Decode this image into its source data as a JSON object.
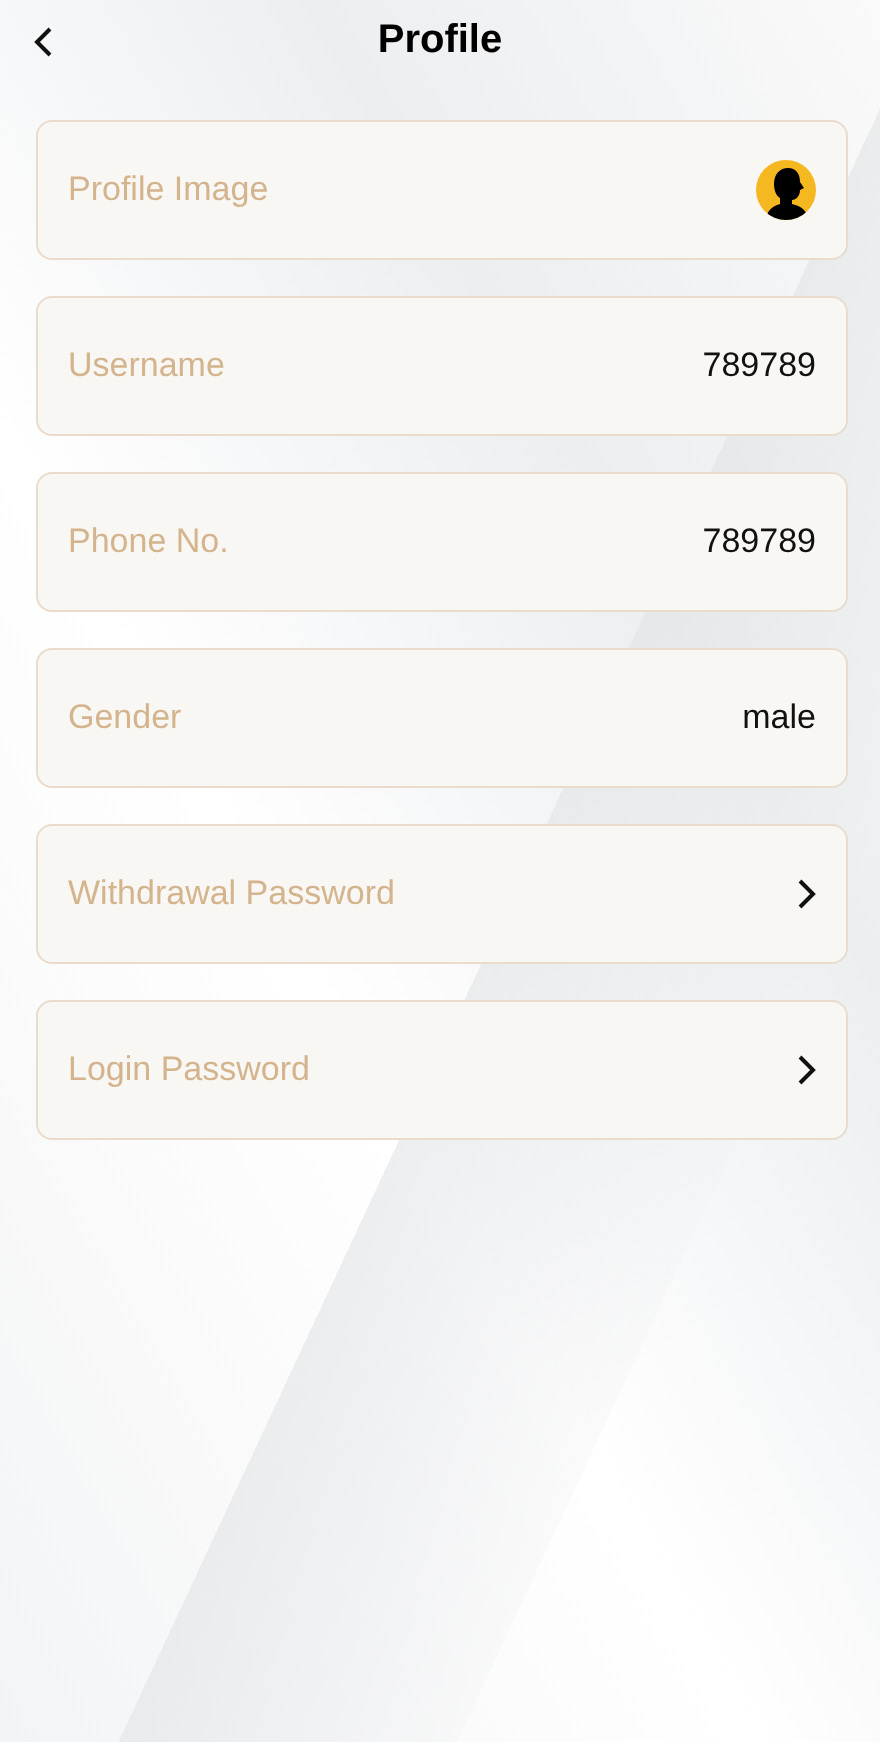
{
  "header": {
    "title": "Profile"
  },
  "rows": [
    {
      "kind": "avatar",
      "label": "Profile Image"
    },
    {
      "kind": "value",
      "label": "Username",
      "value": "789789"
    },
    {
      "kind": "value",
      "label": "Phone No.",
      "value": "789789"
    },
    {
      "kind": "value",
      "label": "Gender",
      "value": "male"
    },
    {
      "kind": "link",
      "label": "Withdrawal Password"
    },
    {
      "kind": "link",
      "label": "Login Password"
    }
  ]
}
